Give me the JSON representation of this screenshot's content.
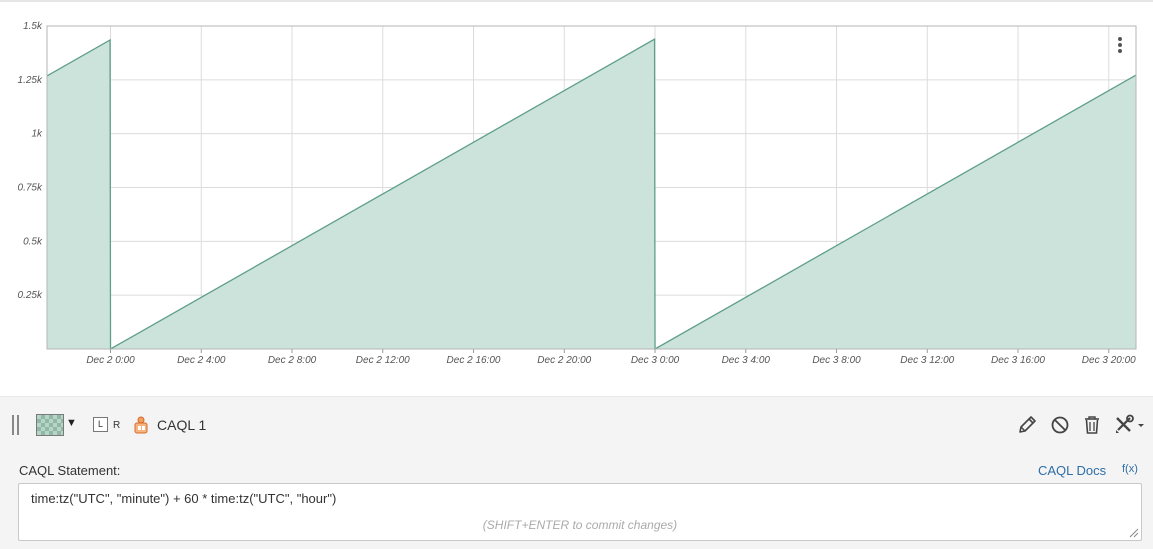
{
  "chart_data": {
    "type": "area",
    "yticks": [
      "1.5k",
      "1.25k",
      "1k",
      "0.75k",
      "0.5k",
      "0.25k"
    ],
    "ytick_values": [
      1500,
      1250,
      1000,
      750,
      500,
      250
    ],
    "ylim": [
      0,
      1500
    ],
    "xticks": [
      "Dec 2 0:00",
      "Dec 2 4:00",
      "Dec 2 8:00",
      "Dec 2 12:00",
      "Dec 2 16:00",
      "Dec 2 20:00",
      "Dec 3 0:00",
      "Dec 3 4:00",
      "Dec 3 8:00",
      "Dec 3 12:00",
      "Dec 3 16:00",
      "Dec 3 20:00"
    ],
    "xtick_hours": [
      0,
      4,
      8,
      12,
      16,
      20,
      24,
      28,
      32,
      36,
      40,
      44
    ],
    "xlim_hours": [
      -2.8,
      45.2
    ],
    "series": [
      {
        "color": "#5e9e8a",
        "fill": "#cce3dc",
        "x_hours": [
          -2.8,
          -0.02,
          0,
          23.98,
          24,
          45.2
        ],
        "y": [
          1268,
          1435,
          0,
          1439,
          0,
          1272
        ]
      }
    ],
    "grid": true,
    "legend": "none"
  },
  "toolbar": {
    "axis_toggle_label": "L",
    "axis_right_label": "R",
    "datapoint_name": "CAQL 1"
  },
  "caql": {
    "label": "CAQL Statement:",
    "docs_link": "CAQL Docs",
    "fx_link": "f(x)",
    "statement": "time:tz(\"UTC\", \"minute\") + 60 * time:tz(\"UTC\", \"hour\")",
    "hint": "(SHIFT+ENTER to commit changes)"
  },
  "colors": {
    "series_line": "#5e9e8a",
    "series_fill": "#cce3dc",
    "link": "#2f6ea6"
  },
  "icons": {
    "drag": "drag-handle-icon",
    "swatch": "color-swatch-icon",
    "caql": "caql-datapoint-icon",
    "edit": "pencil-icon",
    "disable": "disable-icon",
    "delete": "trash-icon",
    "tools": "tools-icon"
  }
}
